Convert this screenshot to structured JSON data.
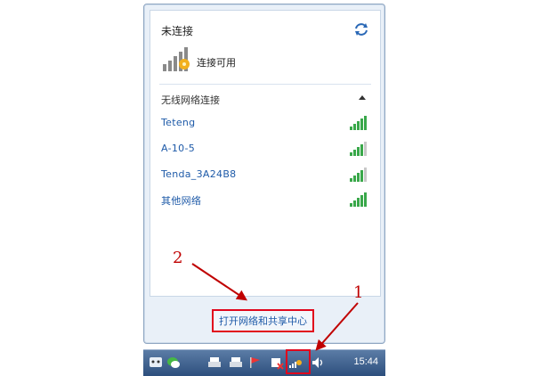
{
  "flyout": {
    "status_title": "未连接",
    "connection_available": "连接可用",
    "section_header": "无线网络连接",
    "networks": [
      {
        "name": "Teteng",
        "signal": 5
      },
      {
        "name": "A-10-5",
        "signal": 4
      },
      {
        "name": "Tenda_3A24B8",
        "signal": 4
      },
      {
        "name": "其他网络",
        "signal": 5
      }
    ],
    "open_center_link": "打开网络和共享中心"
  },
  "taskbar": {
    "clock": "15:44"
  },
  "annotations": {
    "label_1": "1",
    "label_2": "2"
  },
  "colors": {
    "link": "#1e5aa8",
    "annotation": "#c00000",
    "highlight_box": "#e1061c",
    "signal_green": "#39a84a"
  }
}
